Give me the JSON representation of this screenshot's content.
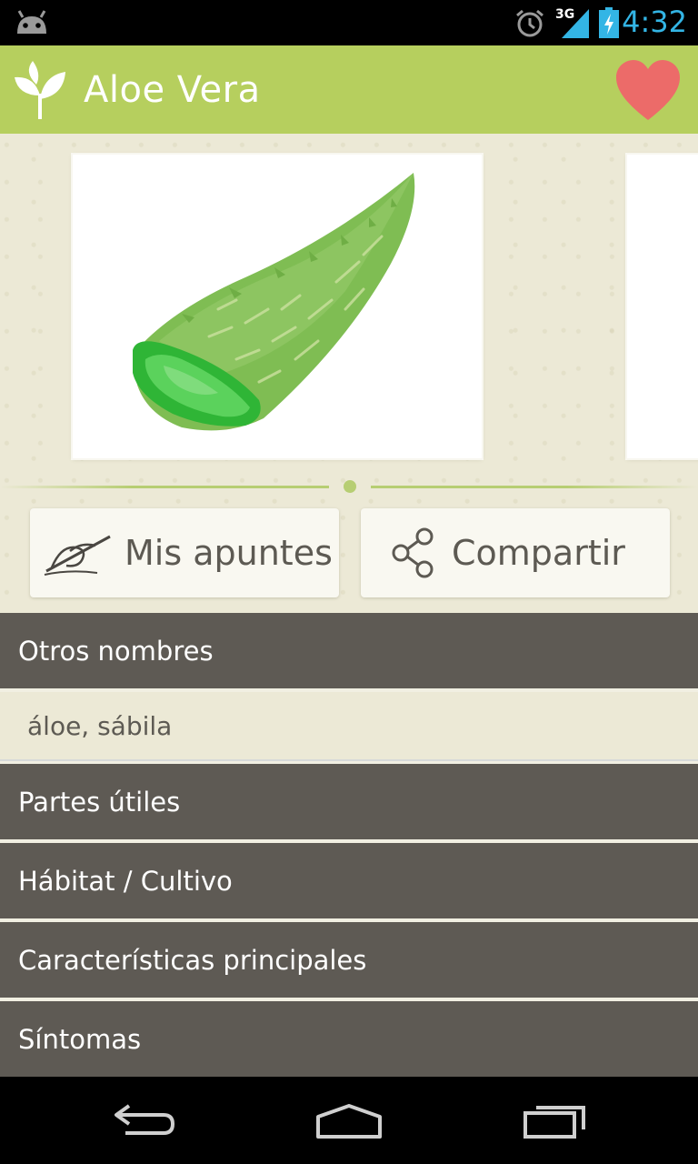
{
  "status_bar": {
    "time": "4:32",
    "network": "3G",
    "icons": [
      "android-debug-icon",
      "alarm-icon",
      "signal-icon",
      "battery-charging-icon"
    ]
  },
  "action_bar": {
    "title": "Aloe Vera",
    "logo_icon": "sprout-icon",
    "favorite_icon": "heart-icon",
    "favorite_color": "#ec6b69",
    "background": "#b6cf5e"
  },
  "gallery": {
    "image": "aloe-vera-leaf-illustration",
    "pages": 1,
    "current_page": 1
  },
  "actions": {
    "notes_label": "Mis apuntes",
    "notes_icon": "pen-writing-icon",
    "share_label": "Compartir",
    "share_icon": "share-icon"
  },
  "sections": [
    {
      "label": "Otros nombres",
      "content": "áloe, sábila"
    },
    {
      "label": "Partes útiles"
    },
    {
      "label": "Hábitat / Cultivo"
    },
    {
      "label": "Características principales"
    },
    {
      "label": "Síntomas"
    }
  ],
  "nav": {
    "icons": [
      "back-icon",
      "home-icon",
      "recent-apps-icon"
    ]
  }
}
